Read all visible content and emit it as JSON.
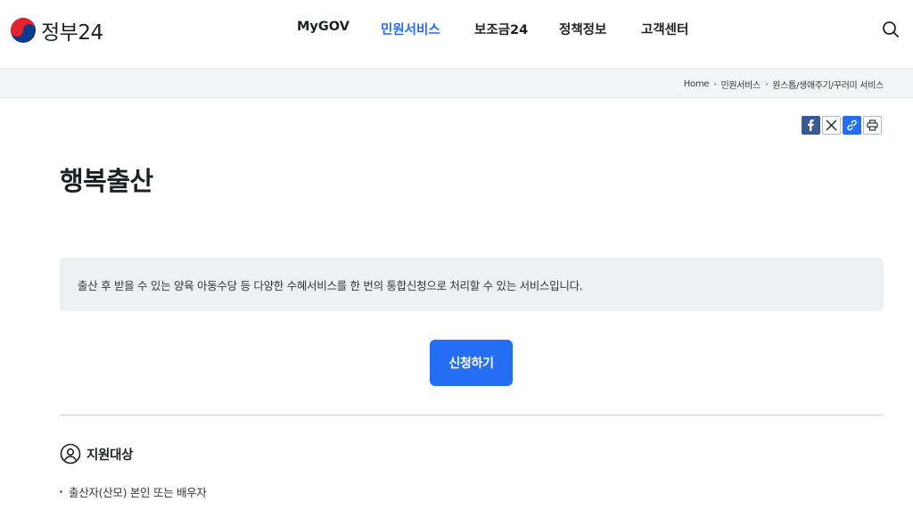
{
  "header": {
    "logo_text": "정부24",
    "nav": [
      {
        "label": "MyGOV",
        "active": false
      },
      {
        "label": "민원서비스",
        "active": true
      },
      {
        "label": "보조금24",
        "active": false
      },
      {
        "label": "정책정보",
        "active": false
      },
      {
        "label": "고객센터",
        "active": false
      }
    ],
    "search_icon": "search-icon"
  },
  "breadcrumb": [
    "Home",
    "민원서비스",
    "원스톱/생애주기/꾸러미 서비스"
  ],
  "share": [
    "facebook-icon",
    "x-icon",
    "link-icon",
    "print-icon"
  ],
  "page": {
    "title": "행복출산",
    "description": "출산 후 받을 수 있는 양육 아동수당 등 다양한 수혜서비스를 한 번의 통합신청으로 처리할 수 있는 서비스입니다.",
    "apply_label": "신청하기"
  },
  "section": {
    "icon": "user-circle-icon",
    "title": "지원대상",
    "items": [
      "출산자(산모) 본인 또는 배우자"
    ]
  },
  "colors": {
    "accent": "#256ef4",
    "desc_bg": "#eef0f4",
    "crumb_bg": "#f4f5f6"
  }
}
